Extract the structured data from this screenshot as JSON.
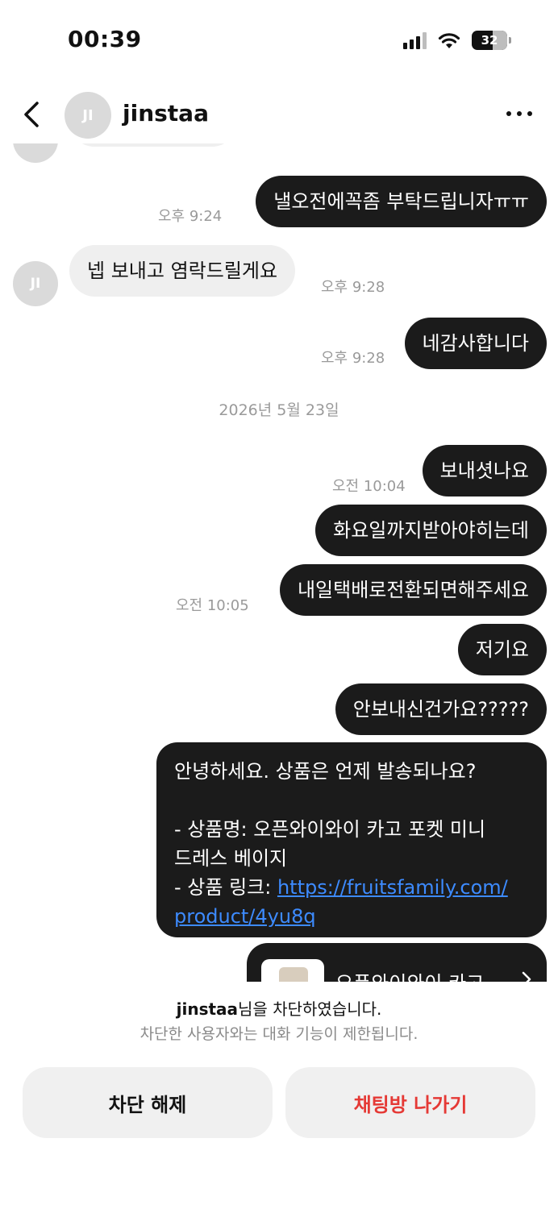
{
  "status_bar": {
    "time": "00:39",
    "battery": "32",
    "battery_level": 0.32
  },
  "header": {
    "avatar_initials": "JI",
    "username": "jinstaa"
  },
  "messages": {
    "m1": {
      "text": "낼오전에꼭좀 부탁드립니자ㅠㅠ",
      "time": "오후 9:24"
    },
    "m2": {
      "text": "넵 보내고 염락드릴게요",
      "time": "오후 9:28",
      "avatar": "JI"
    },
    "m3": {
      "text": "네감사합니다",
      "time": "오후 9:28"
    },
    "date_separator": "2026년 5월 23일",
    "m4": {
      "text": "보내셧나요",
      "time": "오전 10:04"
    },
    "m5": {
      "text": "화요일까지받아야히는데"
    },
    "m6": {
      "text": "내일택배로전환되면해주세요",
      "time": "오전 10:05"
    },
    "m7": {
      "text": "저기요"
    },
    "m8": {
      "text": "안보내신건가요?????"
    },
    "inquiry": {
      "line1": "안녕하세요. 상품은 언제 발송되나요?",
      "line2": "- 상품명: 오픈와이와이 카고 포켓 미니",
      "line3": "드레스 베이지",
      "line4_prefix": "- 상품 링크: ",
      "link_part1": "https://fruitsfamily.com/",
      "link_part2": "product/4yu8q"
    },
    "product_card": {
      "title": "오픈와이와이 카고"
    }
  },
  "blocked": {
    "username": "jinstaa",
    "title_suffix": "님을 차단하였습니다.",
    "subtitle": "차단한 사용자와는 대화 기능이 제한됩니다.",
    "unblock_label": "차단 해제",
    "leave_label": "채팅방 나가기"
  },
  "colors": {
    "outgoing_bubble": "#1b1b1b",
    "incoming_bubble": "#efefef",
    "link": "#3d8bff",
    "danger": "#e53935"
  }
}
